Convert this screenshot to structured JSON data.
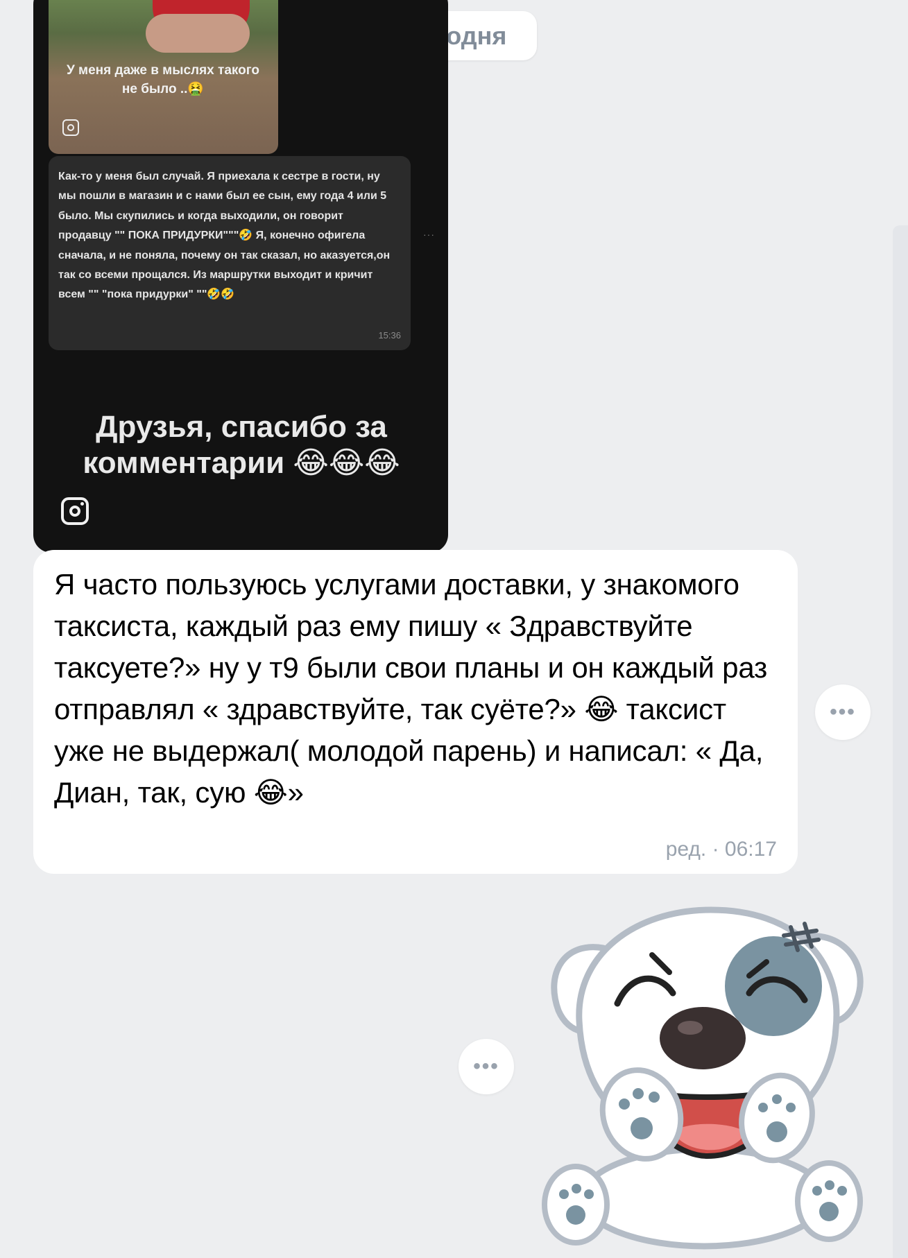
{
  "date_separator": "сегодня",
  "image_message": {
    "photo_caption": "У меня даже в мыслях такого не было ..🤮",
    "inner_comment": "Как-то у меня был случай. Я приехала к сестре в гости, ну мы пошли в магазин и с нами был ее сын, ему года 4 или 5 было. Мы скупились и когда выходили, он говорит продавцу \"\" ПОКА ПРИДУРКИ\"\"\"🤣 Я, конечно офигела сначала, и не поняла, почему он так сказал, но аказуется,он так со всеми прощался. Из маршрутки выходит и кричит всем \"\" \"пока придурки\" \"\"🤣🤣",
    "inner_time": "15:36",
    "inner_menu": "···",
    "caption": "Друзья, спасибо за комментарии 😂😂😂",
    "icons": [
      "instagram-icon"
    ]
  },
  "text_message": {
    "body": "Я часто пользуюсь услугами доставки, у знакомого таксиста, каждый раз ему пишу « Здравствуйте таксуете?» ну у т9 были свои планы и он каждый раз отправлял « здравствуйте, так суёте?» 😂 таксист уже не выдержал( молодой парень) и написал: « Да, Диан, так, сую 😂»",
    "meta": "ред. · 06:17"
  },
  "menu_label": "•••",
  "sticker": {
    "name": "laughing-white-dog-sticker"
  },
  "colors": {
    "background": "#edeef0",
    "bubble": "#ffffff",
    "meta_text": "#99a2ad",
    "dark_card": "#121212"
  }
}
